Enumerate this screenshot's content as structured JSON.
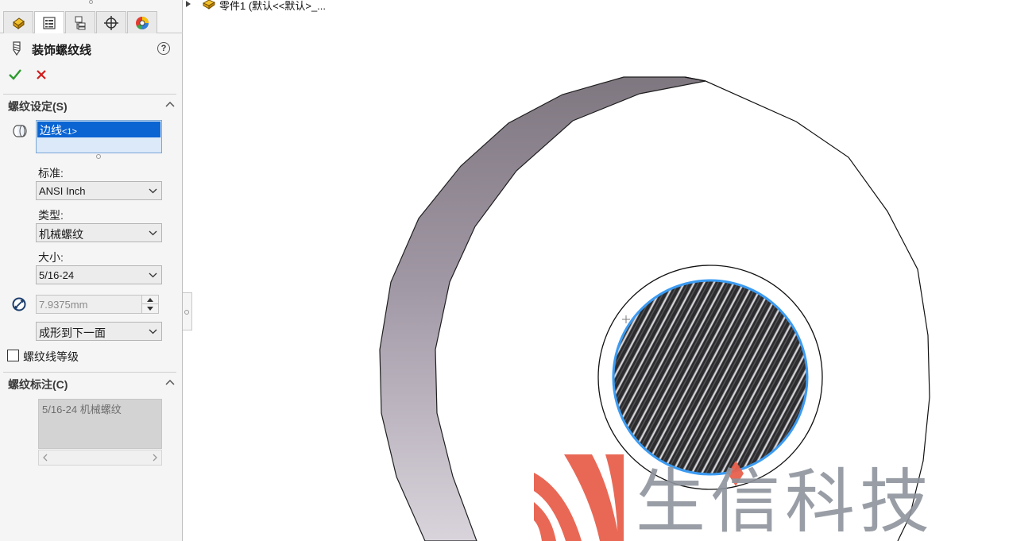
{
  "property_manager": {
    "tabs": [
      {
        "name": "feature-manager-tab",
        "icon": "feature-manager-icon",
        "active": false
      },
      {
        "name": "property-manager-tab",
        "icon": "property-manager-icon",
        "active": true
      },
      {
        "name": "configuration-manager-tab",
        "icon": "configuration-manager-icon",
        "active": false
      },
      {
        "name": "dimxpert-manager-tab",
        "icon": "dimxpert-icon",
        "active": false
      },
      {
        "name": "display-manager-tab",
        "icon": "display-manager-icon",
        "active": false
      }
    ],
    "title": "装饰螺纹线",
    "help_label": "?",
    "thread_settings": {
      "header": "螺纹设定(S)",
      "selected_edge": "边线",
      "selected_edge_suffix": "<1>",
      "standard_label": "标准:",
      "standard_value": "ANSI Inch",
      "type_label": "类型:",
      "type_value": "机械螺纹",
      "size_label": "大小:",
      "size_value": "5/16-24",
      "diameter_value": "7.9375mm",
      "end_condition_value": "成形到下一面",
      "thread_class_label": "螺纹线等级",
      "thread_class_checked": false
    },
    "thread_callout": {
      "header": "螺纹标注(C)",
      "text": "5/16-24 机械螺纹"
    }
  },
  "tree": {
    "part_label": "零件1 (默认<<默认>_..."
  },
  "watermark": {
    "text": "生信科技",
    "accent_color": "#e8604c"
  },
  "colors": {
    "selection_blue": "#0a64d2",
    "edge_highlight": "#3b9bf2",
    "ok_green": "#2e9a2e",
    "cancel_red": "#d21b1b"
  }
}
